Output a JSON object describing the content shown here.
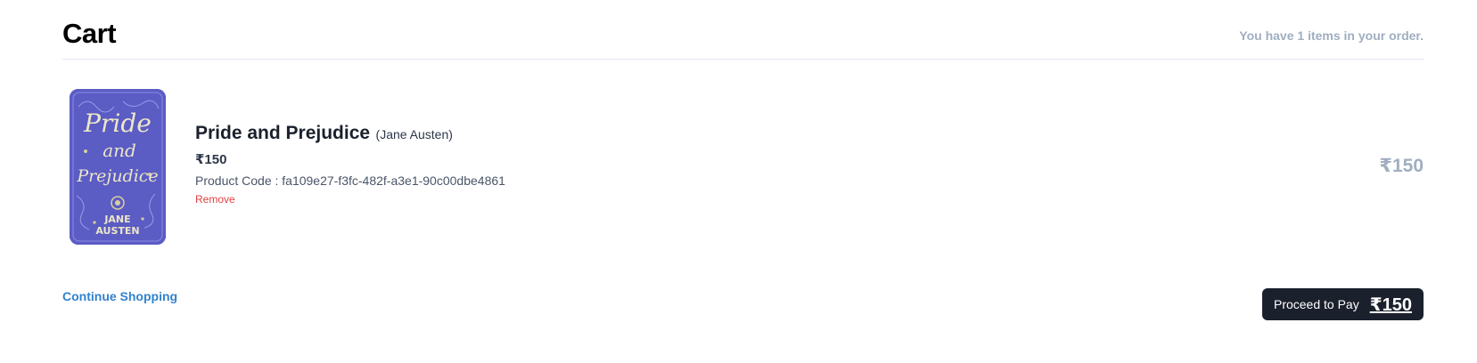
{
  "header": {
    "title": "Cart",
    "summary": "You have 1 items in your order."
  },
  "cart": {
    "items": [
      {
        "title": "Pride and Prejudice",
        "author": "(Jane Austen)",
        "price": "₹150",
        "code": "Product Code : fa109e27-f3fc-482f-a3e1-90c00dbe4861",
        "remove_label": "Remove",
        "line_total": "₹150",
        "cover": {
          "title_line1": "Pride",
          "title_line2": "and",
          "title_line3": "Prejudice",
          "author_line1": "JANE",
          "author_line2": "AUSTEN",
          "background": "#5b5cc4",
          "text_color": "#ece6c8"
        }
      }
    ]
  },
  "footer": {
    "continue_label": "Continue Shopping",
    "pay_label": "Proceed to Pay",
    "pay_amount": "₹150"
  },
  "colors": {
    "accent_link": "#3182ce",
    "danger": "#e53e3e",
    "muted": "#a0aec0",
    "dark_button": "#1a202c"
  }
}
